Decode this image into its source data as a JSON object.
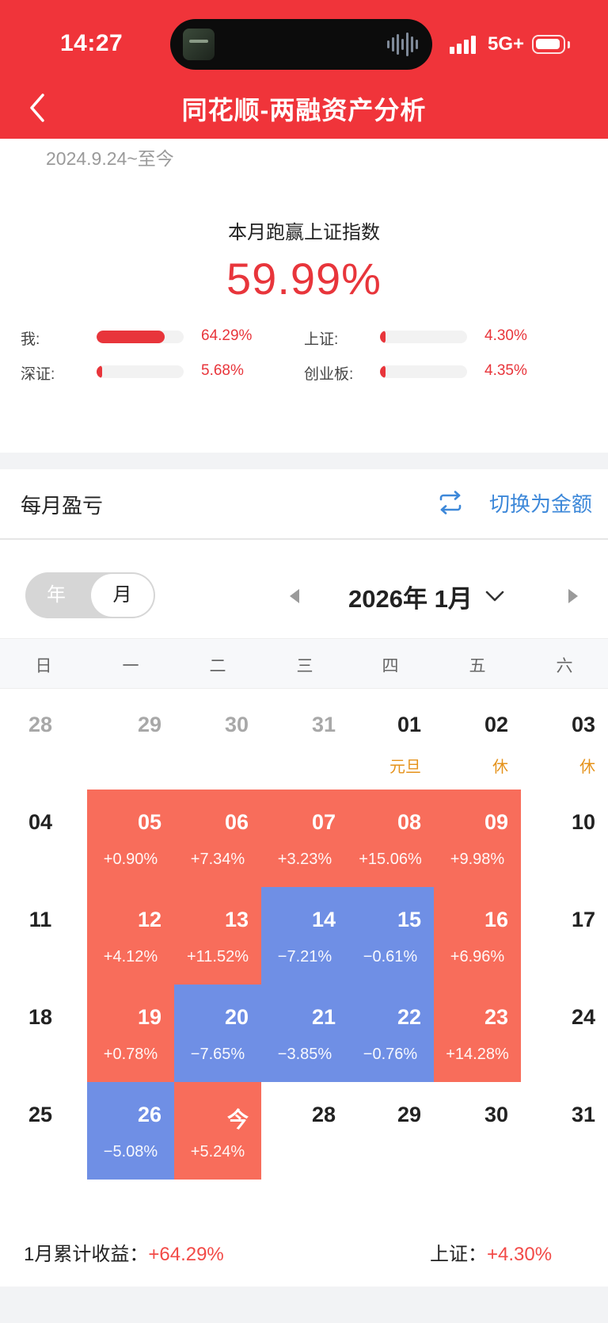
{
  "status_bar": {
    "time": "14:27",
    "network": "5G+"
  },
  "header": {
    "title": "同花顺-两融资产分析"
  },
  "summary": {
    "period": "2024.9.24~至今",
    "beat_label": "本月跑赢上证指数",
    "beat_value": "59.99%",
    "comparisons": [
      {
        "label": "我:",
        "value": "64.29%",
        "ratio": 0.78
      },
      {
        "label": "上证:",
        "value": "4.30%",
        "ratio": 0.04
      },
      {
        "label": "深证:",
        "value": "5.68%",
        "ratio": 0.04
      },
      {
        "label": "创业板:",
        "value": "4.35%",
        "ratio": 0.04
      }
    ]
  },
  "monthly": {
    "title": "每月盈亏",
    "switch_label": "切换为金额",
    "seg_year": "年",
    "seg_month": "月",
    "month_label": "2026年 1月",
    "weekdays": [
      "日",
      "一",
      "二",
      "三",
      "四",
      "五",
      "六"
    ],
    "weeks": [
      [
        {
          "day": "28",
          "muted": true
        },
        {
          "day": "29",
          "muted": true
        },
        {
          "day": "30",
          "muted": true
        },
        {
          "day": "31",
          "muted": true
        },
        {
          "day": "01",
          "note": "元旦"
        },
        {
          "day": "02",
          "note": "休"
        },
        {
          "day": "03",
          "note": "休"
        }
      ],
      [
        {
          "day": "04"
        },
        {
          "day": "05",
          "pct": "+0.90%",
          "tone": "pos"
        },
        {
          "day": "06",
          "pct": "+7.34%",
          "tone": "pos"
        },
        {
          "day": "07",
          "pct": "+3.23%",
          "tone": "pos"
        },
        {
          "day": "08",
          "pct": "+15.06%",
          "tone": "pos"
        },
        {
          "day": "09",
          "pct": "+9.98%",
          "tone": "pos"
        },
        {
          "day": "10"
        }
      ],
      [
        {
          "day": "11"
        },
        {
          "day": "12",
          "pct": "+4.12%",
          "tone": "pos"
        },
        {
          "day": "13",
          "pct": "+11.52%",
          "tone": "pos"
        },
        {
          "day": "14",
          "pct": "−7.21%",
          "tone": "neg"
        },
        {
          "day": "15",
          "pct": "−0.61%",
          "tone": "neg"
        },
        {
          "day": "16",
          "pct": "+6.96%",
          "tone": "pos"
        },
        {
          "day": "17"
        }
      ],
      [
        {
          "day": "18"
        },
        {
          "day": "19",
          "pct": "+0.78%",
          "tone": "pos"
        },
        {
          "day": "20",
          "pct": "−7.65%",
          "tone": "neg"
        },
        {
          "day": "21",
          "pct": "−3.85%",
          "tone": "neg"
        },
        {
          "day": "22",
          "pct": "−0.76%",
          "tone": "neg"
        },
        {
          "day": "23",
          "pct": "+14.28%",
          "tone": "pos"
        },
        {
          "day": "24"
        }
      ],
      [
        {
          "day": "25"
        },
        {
          "day": "26",
          "pct": "−5.08%",
          "tone": "neg"
        },
        {
          "day": "今",
          "pct": "+5.24%",
          "tone": "pos"
        },
        {
          "day": "28"
        },
        {
          "day": "29"
        },
        {
          "day": "30"
        },
        {
          "day": "31"
        }
      ]
    ],
    "footer": {
      "total_label": "1月累计收益：",
      "total_value": "+64.29%",
      "index_label": "上证：",
      "index_value": "+4.30%"
    }
  },
  "colors": {
    "header": "#f0343a",
    "gain": "#f86d5b",
    "loss": "#6f8fe5",
    "accent_text": "#e8353b",
    "link": "#3d88d9",
    "holiday": "#e5921a"
  }
}
